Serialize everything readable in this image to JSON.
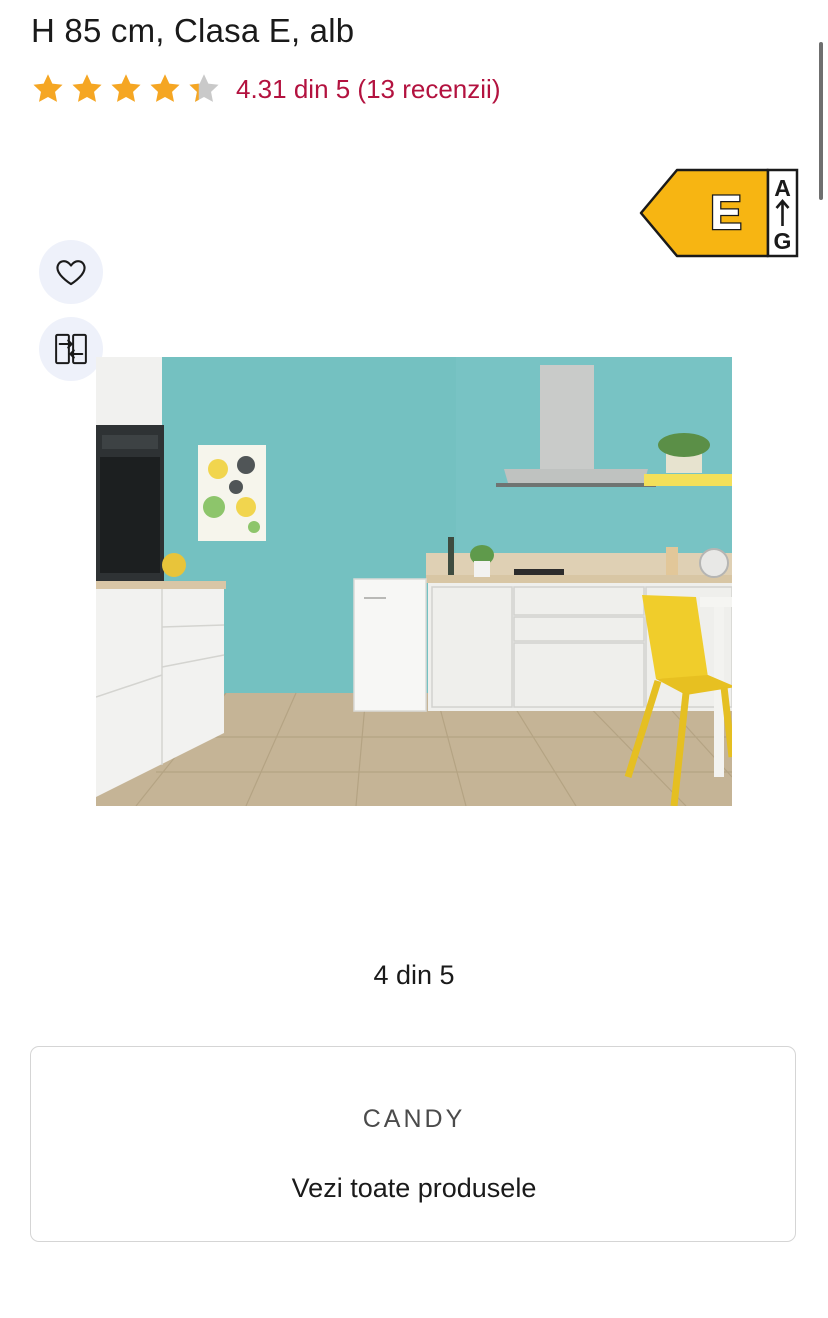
{
  "product": {
    "title": "H 85 cm, Clasa E, alb",
    "rating": {
      "value": 4.31,
      "max": 5,
      "text": "4.31 din 5 (13 recenzii)",
      "star_color": "#f5a623",
      "empty_star_color": "#c9c9c9",
      "text_color": "#b3123f"
    },
    "energy_label": {
      "class": "E",
      "scale_top": "A",
      "scale_bottom": "G",
      "color": "#f7b512"
    }
  },
  "actions": {
    "favorite_icon": "heart-icon",
    "compare_icon": "compare-icon"
  },
  "gallery": {
    "counter": "4 din 5",
    "current": 4,
    "total": 5,
    "image_alt": "kitchen-scene"
  },
  "brand": {
    "logo_text": "CANDY",
    "link_label": "Vezi toate produsele"
  }
}
